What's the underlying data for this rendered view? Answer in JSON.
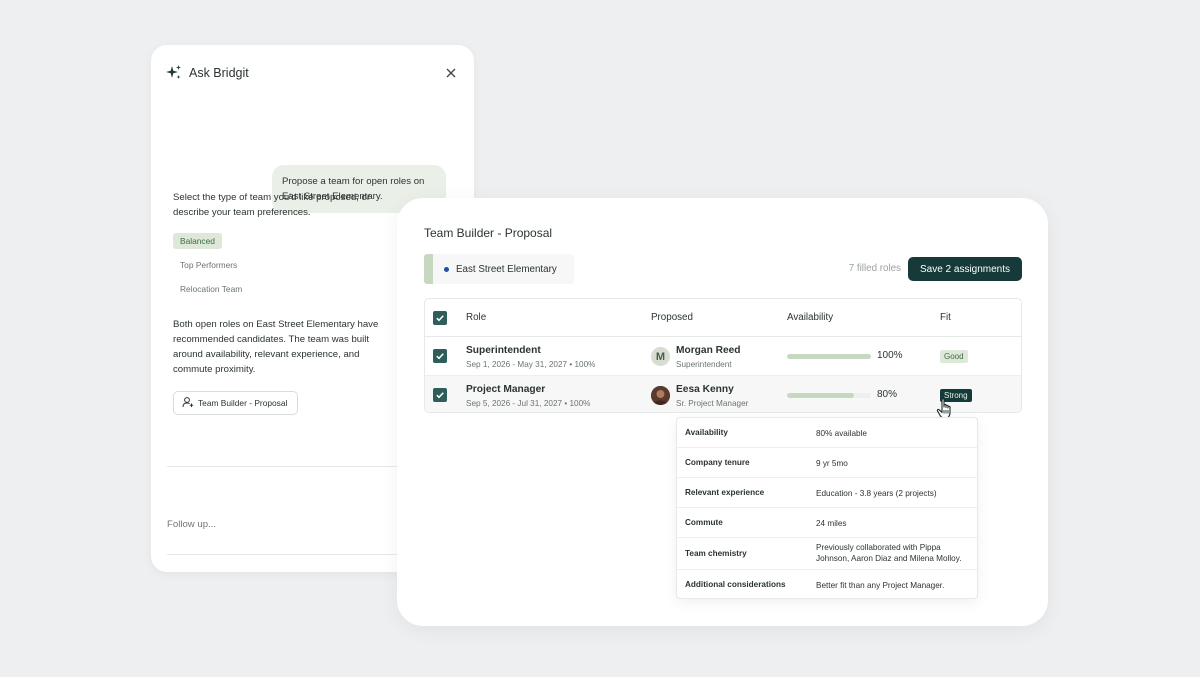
{
  "chat": {
    "title": "Ask Bridgit",
    "user_message": "Propose a team for open roles on East Street Elementary.",
    "prompt": "Select the type of team you'd like proposed, or describe your team preferences.",
    "options": [
      "Balanced",
      "Top Performers",
      "Relocation Team"
    ],
    "selected_option": "Balanced",
    "summary": "Both open roles on East Street Elementary have recommended candidates. The team was built around availability, relevant experience, and commute proximity.",
    "proposal_link": "Team Builder - Proposal",
    "follow_up_placeholder": "Follow up..."
  },
  "builder": {
    "title": "Team Builder - Proposal",
    "project": "East Street Elementary",
    "filled_roles": "7 filled roles",
    "save_label": "Save 2 assignments",
    "columns": [
      "Role",
      "Proposed",
      "Availability",
      "Fit"
    ],
    "rows": [
      {
        "role": "Superintendent",
        "dates": "Sep 1, 2026 - May 31, 2027  • 100%",
        "avatar_letter": "M",
        "name": "Morgan Reed",
        "title": "Superintendent",
        "availability": 100,
        "availability_label": "100%",
        "fit": "Good"
      },
      {
        "role": "Project Manager",
        "dates": "Sep 5, 2026 - Jul 31, 2027  • 100%",
        "avatar_letter": "",
        "name": "Eesa Kenny",
        "title": "Sr. Project Manager",
        "availability": 80,
        "availability_label": "80%",
        "fit": "Strong"
      }
    ],
    "details": [
      {
        "label": "Availability",
        "value": "80% available"
      },
      {
        "label": "Company tenure",
        "value": "9 yr 5mo"
      },
      {
        "label": "Relevant experience",
        "value": "Education - 3.8 years (2 projects)"
      },
      {
        "label": "Commute",
        "value": "24 miles"
      },
      {
        "label": "Team chemistry",
        "value": "Previously collaborated with Pippa Johnson, Aaron Diaz and Milena Molloy."
      },
      {
        "label": "Additional considerations",
        "value": "Better fit than any Project Manager."
      }
    ]
  },
  "colors": {
    "accent_dark": "#163a3a",
    "fit_good_bg": "#dde8d8",
    "availability_fill": "#c6d8c0",
    "project_dot": "#1f4fa8"
  },
  "icons": [
    "sparkle-icon",
    "close-icon",
    "user-icon",
    "check-icon",
    "pointer-hand-icon"
  ]
}
